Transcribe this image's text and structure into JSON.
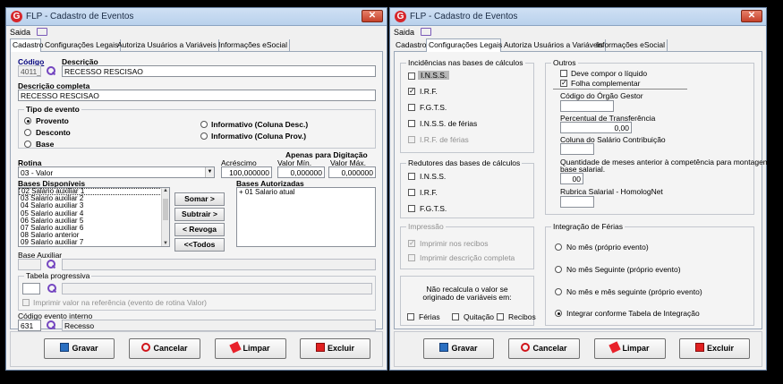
{
  "window1": {
    "title": "FLP - Cadastro de Eventos",
    "close": "✕",
    "menu": "Saida",
    "tabs": [
      "Cadastro",
      "Configurações Legais",
      "Autoriza Usuários a Variáveis",
      "Informações eSocial"
    ],
    "codigo_label": "Código",
    "codigo_value": "4011_",
    "descricao_label": "Descrição",
    "descricao_value": "RECESSO RESCISAO",
    "desc_completa_label": "Descrição completa",
    "desc_completa_value": "RECESSO RESCISAO",
    "tipo_label": "Tipo de evento",
    "tipo_opts": [
      "Provento",
      "Desconto",
      "Base",
      "Informativo (Coluna Desc.)",
      "Informativo (Coluna Prov.)"
    ],
    "rotina_label": "Rotina",
    "rotina_value": "03 - Valor",
    "acrescimo_label": "Acréscimo",
    "acrescimo_value": "100,000000",
    "apenas_label": "Apenas para Digitação",
    "valor_min_label": "Valor Mín.",
    "valor_min_value": "0,000000",
    "valor_max_label": "Valor Máx.",
    "valor_max_value": "0,000000",
    "bases_disp_label": "Bases Disponíveis",
    "bases_disp": [
      "02 Salario auxiliar 1",
      "03 Salario auxiliar 2",
      "04 Salario auxiliar 3",
      "05 Salario auxiliar 4",
      "06 Salario auxiliar 5",
      "07 Salario auxiliar 6",
      "08 Salario anterior",
      "09 Salario auxiliar 7"
    ],
    "btn_somar": "Somar >",
    "btn_subtrair": "Subtrair >",
    "btn_revoga": "< Revoga",
    "btn_todos": "<<Todos",
    "bases_aut_label": "Bases Autorizadas",
    "bases_aut": [
      "+ 01 Salario atual"
    ],
    "base_aux_label": "Base Auxiliar",
    "tabela_label": "Tabela progressiva",
    "imprimir_label": "Imprimir valor na referência (evento de rotina Valor)",
    "codigo_int_label": "Código evento interno",
    "codigo_int_value": "631",
    "codigo_int_desc": "Recesso"
  },
  "window2": {
    "title": "FLP - Cadastro de Eventos",
    "close": "✕",
    "menu": "Saida",
    "tabs": [
      "Cadastro",
      "Configurações Legais",
      "Autoriza Usuários a Variáveis",
      "Informações eSocial"
    ],
    "incid_label": "Incidências nas bases de cálculos",
    "incid": [
      "I.N.S.S.",
      "I.R.F.",
      "F.G.T.S.",
      "I.N.S.S. de férias",
      "I.R.F. de férias"
    ],
    "redut_label": "Redutores das bases de cálculos",
    "redut": [
      "I.N.S.S.",
      "I.R.F.",
      "F.G.T.S."
    ],
    "impressao_label": "Impressão",
    "impressao": [
      "Imprimir nos recibos",
      "Imprimir descrição completa"
    ],
    "nao_recalc": [
      "Não recalcula o valor se",
      "originado de variáveis em:"
    ],
    "recalc_opts": [
      "Férias",
      "Quitação",
      "Recibos"
    ],
    "outros_label": "Outros",
    "outros": [
      "Deve compor o líquido",
      "Folha complementar"
    ],
    "orgao_label": "Código do Órgão Gestor",
    "perc_label": "Percentual de Transferência",
    "perc_value": "0,00",
    "coluna_label": "Coluna do Salário Contribuição",
    "qtd_label": [
      "Quantidade de meses anterior à competência para montagem da",
      "base salarial."
    ],
    "qtd_value": "00",
    "rubrica_label": "Rubrica Salarial - HomologNet",
    "integ_label": "Integração de Férias",
    "integ": [
      "No mês (próprio evento)",
      "No mês Seguinte (próprio evento)",
      "No mês e mês seguinte (próprio evento)",
      "Integrar conforme Tabela de Integração"
    ]
  },
  "footer": {
    "gravar": "Gravar",
    "cancelar": "Cancelar",
    "limpar": "Limpar",
    "excluir": "Excluir"
  }
}
